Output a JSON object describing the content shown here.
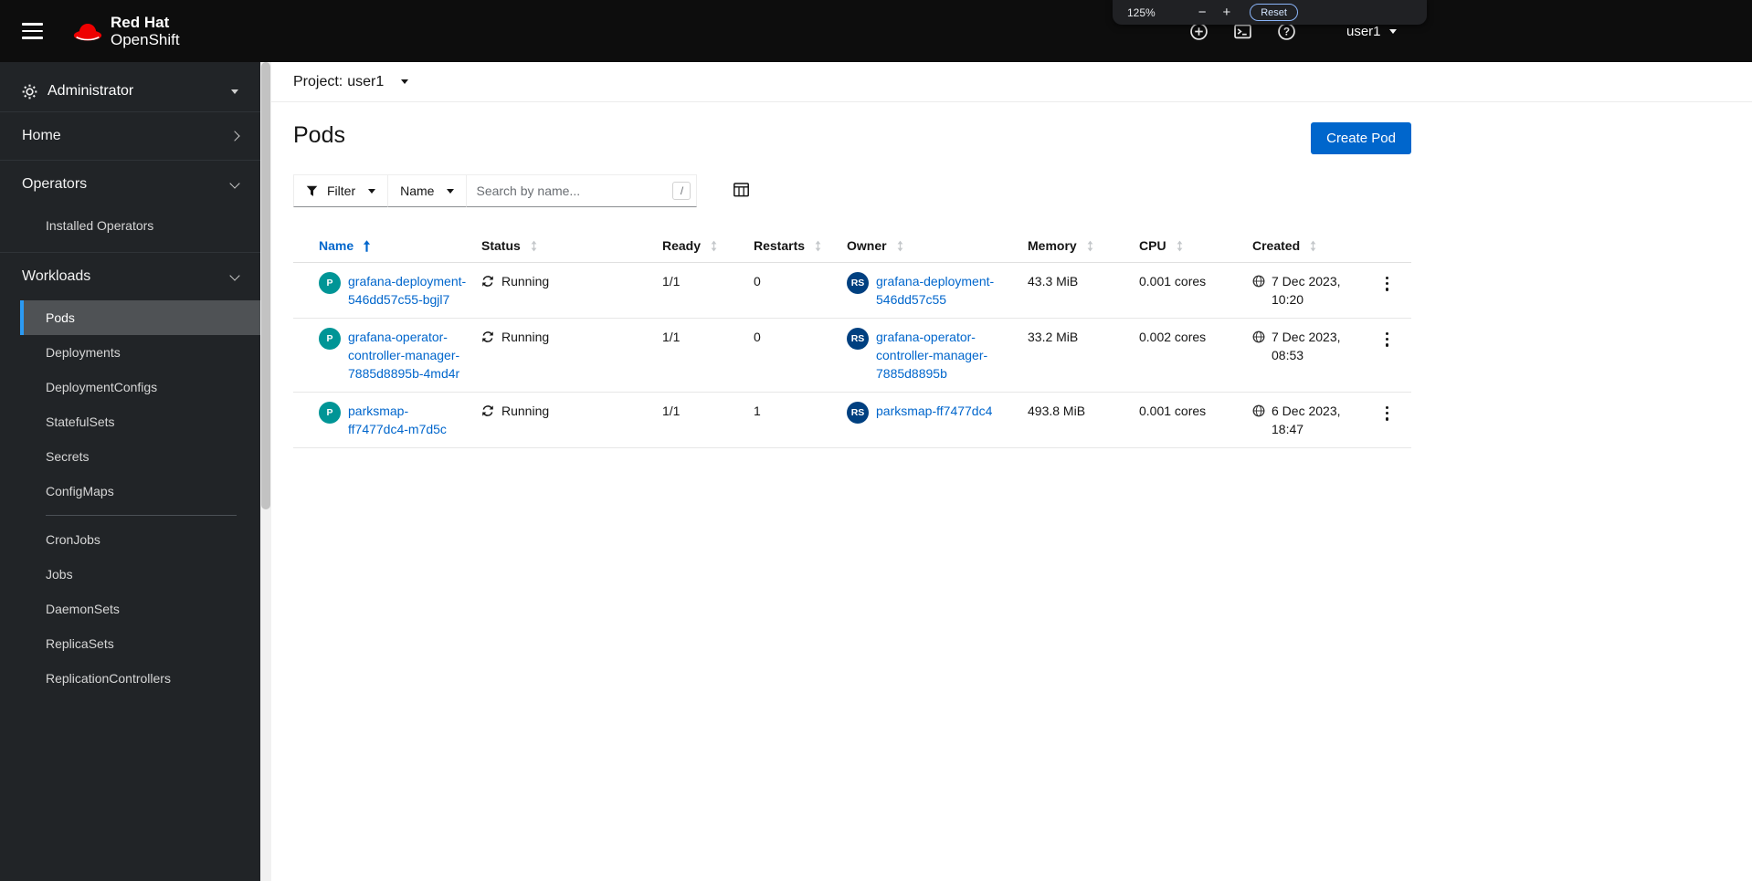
{
  "masthead": {
    "brand_line1": "Red Hat",
    "brand_line2": "OpenShift",
    "user": "user1"
  },
  "zoom_popup": {
    "level": "125%",
    "minus": "−",
    "plus": "+",
    "reset_label": "Reset"
  },
  "sidebar": {
    "perspective": "Administrator",
    "home": "Home",
    "operators": "Operators",
    "operators_items": [
      "Installed Operators"
    ],
    "workloads": "Workloads",
    "workloads_items": [
      "Pods",
      "Deployments",
      "DeploymentConfigs",
      "StatefulSets",
      "Secrets",
      "ConfigMaps",
      "CronJobs",
      "Jobs",
      "DaemonSets",
      "ReplicaSets",
      "ReplicationControllers"
    ],
    "active_item": "Pods"
  },
  "project_bar": {
    "label": "Project:",
    "value": "user1"
  },
  "page": {
    "title": "Pods",
    "create_button": "Create Pod"
  },
  "toolbar": {
    "filter_label": "Filter",
    "search_attribute": "Name",
    "search_placeholder": "Search by name...",
    "search_value": "",
    "shortcut_hint": "/"
  },
  "table": {
    "columns": [
      "Name",
      "Status",
      "Ready",
      "Restarts",
      "Owner",
      "Memory",
      "CPU",
      "Created"
    ],
    "sorted_by": "Name",
    "sort_direction": "ascending",
    "rows": [
      {
        "badge": "P",
        "name": "grafana-deployment-546dd57c55-bgjl7",
        "status": "Running",
        "ready": "1/1",
        "restarts": "0",
        "owner_badge": "RS",
        "owner": "grafana-deployment-546dd57c55",
        "memory": "43.3 MiB",
        "cpu": "0.001 cores",
        "created": "7 Dec 2023, 10:20"
      },
      {
        "badge": "P",
        "name": "grafana-operator-controller-manager-7885d8895b-4md4r",
        "status": "Running",
        "ready": "1/1",
        "restarts": "0",
        "owner_badge": "RS",
        "owner": "grafana-operator-controller-manager-7885d8895b",
        "memory": "33.2 MiB",
        "cpu": "0.002 cores",
        "created": "7 Dec 2023, 08:53"
      },
      {
        "badge": "P",
        "name": "parksmap-ff7477dc4-m7d5c",
        "status": "Running",
        "ready": "1/1",
        "restarts": "1",
        "owner_badge": "RS",
        "owner": "parksmap-ff7477dc4",
        "memory": "493.8 MiB",
        "cpu": "0.001 cores",
        "created": "6 Dec 2023, 18:47"
      }
    ]
  },
  "colors": {
    "accent_blue": "#0066cc",
    "link_blue": "#0066cc",
    "pod_badge": "#009596",
    "replicaset_badge": "#004080",
    "nav_active_indicator": "#2b9af3",
    "masthead_bg": "#0d0d0d",
    "sidebar_bg": "#212427",
    "brand_red": "#ee0000"
  }
}
